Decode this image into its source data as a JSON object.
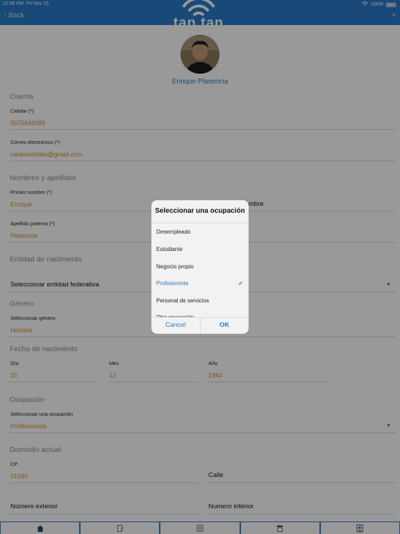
{
  "status": {
    "time": "12:58 PM",
    "date": "Fri Nov 15",
    "battery": "100%"
  },
  "nav": {
    "back_label": "Back",
    "logo_text": "tan tan"
  },
  "profile": {
    "name": "Enrique Plasencia"
  },
  "account": {
    "section": "Cuenta",
    "phone_label": "Celular (*)",
    "phone_value": "5575645089",
    "email_label": "Correo electrónico (*)",
    "email_value": "cantoniohdez@gmail.com"
  },
  "names": {
    "section": "Nombres y apellidos",
    "first_label": "Primer nombre (*)",
    "first_value": "Enrique",
    "second_partial": "mbre",
    "paternal_label": "Apellido paterno (*)",
    "paternal_value": "Plasencia"
  },
  "birthplace": {
    "section": "Entidad de nacimiento",
    "select_value": "Seleccionar entidad federativa"
  },
  "gender": {
    "section": "Género",
    "label": "Seleccionar género",
    "value": "Hombre"
  },
  "birthdate": {
    "section": "Fecha de nacimiento",
    "day_label": "Día",
    "day_value": "20",
    "month_label": "Mes",
    "month_value": "12",
    "year_label": "Año",
    "year_value": "1984"
  },
  "occupation": {
    "section": "Ocupación",
    "label": "Seleccionar una ocupación",
    "value": "Profesionista"
  },
  "address": {
    "section": "Domicilio actual",
    "cp_label": "CP",
    "cp_value": "01030",
    "street_label": "Calle",
    "ext_label": "Número exterior",
    "int_label": "Numero interior"
  },
  "dialog": {
    "title": "Seleccionar una ocupación",
    "options": [
      "Desempleado",
      "Estudiante",
      "Negocio propio",
      "Profesionista",
      "Personal de servicios",
      "Otra ocupación"
    ],
    "cancel": "Cancel",
    "ok": "OK"
  },
  "colors": {
    "accent": "#2b7ac8",
    "value": "#e0882c"
  }
}
